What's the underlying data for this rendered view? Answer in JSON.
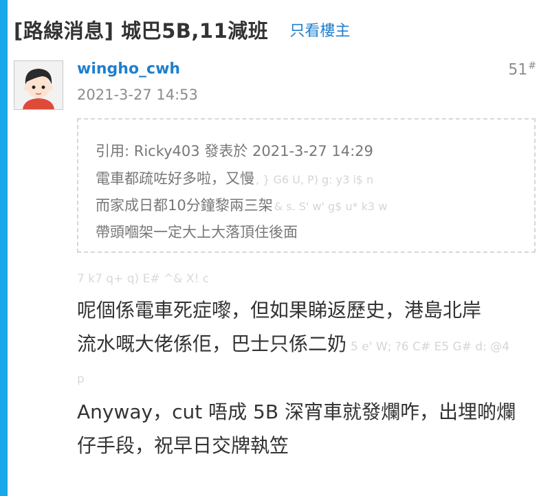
{
  "thread": {
    "title": "[路線消息] 城巴5B,11減班",
    "only_op_link": "只看樓主"
  },
  "post": {
    "username": "wingho_cwh",
    "time": "2021-3-27 14:53",
    "floor": "51",
    "floor_mark": "#",
    "quote": {
      "header": "引用: Ricky403 發表於 2021-3-27 14:29",
      "lines": [
        {
          "text": "電車都疏咗好多啦，又慢",
          "junk": ", } G6 U, P) g: y3 i$ n"
        },
        {
          "text": "而家成日都10分鐘黎兩三架",
          "junk": "& s. S' w' g$ u* k3 w"
        },
        {
          "text": "帶頭嗰架一定大上大落頂住後面",
          "junk": ""
        }
      ]
    },
    "junk_line": "7 k7 q+ q) E# ^& X! c",
    "body": {
      "p1_line1": "呢個係電車死症嚟，但如果睇返歷史，港島北岸",
      "p1_line2": "流水嘅大佬係佢，巴士只係二奶",
      "p1_junk": "5 e' W; ?6 C# E5 G# d: @4",
      "p1_junk_tail": "p",
      "p2_line1": "Anyway，cut 唔成 5B 深宵車就發爛咋，出埋啲爛",
      "p2_line2": "仔手段，祝早日交牌執笠"
    }
  },
  "colors": {
    "accent_bar": "#1aa7ec",
    "link": "#1f7fd0",
    "meta_text": "#8c8c8c",
    "body_text": "#333333",
    "junk_text": "#d5d5d5"
  },
  "icons": {
    "avatar": "default-avatar"
  }
}
